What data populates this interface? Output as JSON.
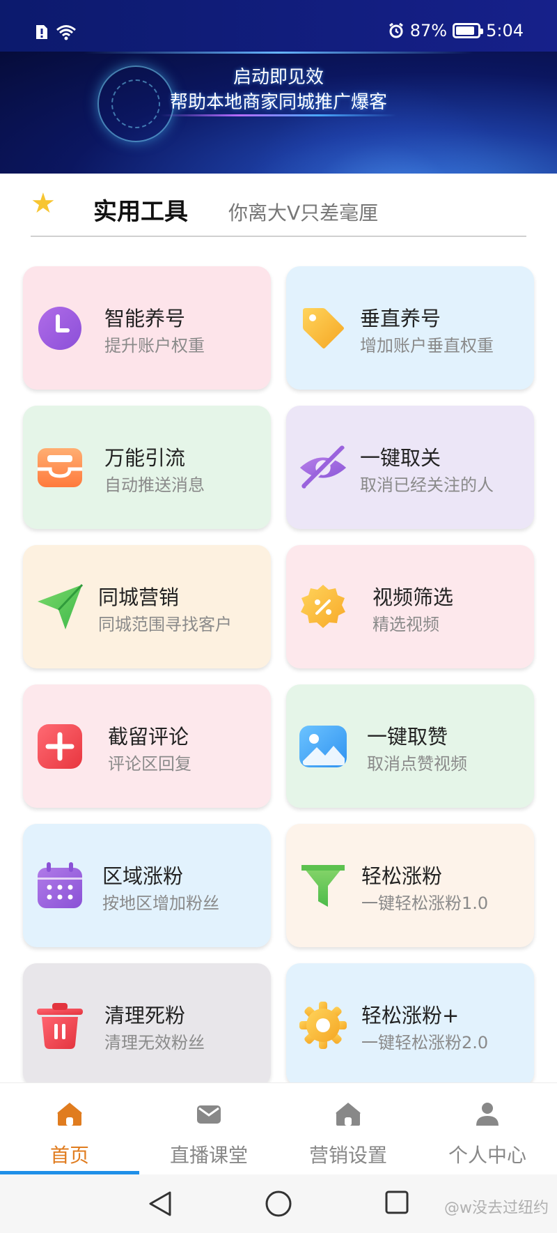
{
  "status_bar": {
    "battery": "87%",
    "battery_level": 0.87,
    "time": "5:04"
  },
  "banner": {
    "line1": "启动即见效",
    "line2": "帮助本地商家同城推广爆客"
  },
  "section": {
    "title": "实用工具",
    "subtitle": "你离大V只差毫厘"
  },
  "tools": [
    {
      "title": "智能养号",
      "subtitle": "提升账户权重",
      "bg": "#fde4ea",
      "icon": "clock-icon"
    },
    {
      "title": "垂直养号",
      "subtitle": "增加账户垂直权重",
      "bg": "#e2f2fd",
      "icon": "tag-icon"
    },
    {
      "title": "万能引流",
      "subtitle": "自动推送消息",
      "bg": "#e5f5e8",
      "icon": "inbox-icon"
    },
    {
      "title": "一键取关",
      "subtitle": "取消已经关注的人",
      "bg": "#ece6f7",
      "icon": "eye-off-icon"
    },
    {
      "title": "同城营销",
      "subtitle": "同城范围寻找客户",
      "bg": "#fdf1e0",
      "icon": "send-icon"
    },
    {
      "title": "视频筛选",
      "subtitle": "精选视频",
      "bg": "#fde8ec",
      "icon": "discount-badge-icon"
    },
    {
      "title": "截留评论",
      "subtitle": "评论区回复",
      "bg": "#fde8ec",
      "icon": "plus-square-icon"
    },
    {
      "title": "一键取赞",
      "subtitle": "取消点赞视频",
      "bg": "#e5f5e8",
      "icon": "image-icon"
    },
    {
      "title": "区域涨粉",
      "subtitle": "按地区增加粉丝",
      "bg": "#e2f2fd",
      "icon": "calendar-icon"
    },
    {
      "title": "轻松涨粉",
      "subtitle": "一键轻松涨粉1.0",
      "bg": "#fdf3ea",
      "icon": "funnel-icon"
    },
    {
      "title": "清理死粉",
      "subtitle": "清理无效粉丝",
      "bg": "#e8e6ea",
      "icon": "trash-icon"
    },
    {
      "title": "轻松涨粉+",
      "subtitle": "一键轻松涨粉2.0",
      "bg": "#e2f2fd",
      "icon": "gear-icon"
    }
  ],
  "nav": [
    {
      "label": "首页",
      "icon": "home-icon",
      "active": true
    },
    {
      "label": "直播课堂",
      "icon": "mail-icon",
      "active": false
    },
    {
      "label": "营销设置",
      "icon": "home-icon",
      "active": false
    },
    {
      "label": "个人中心",
      "icon": "user-icon",
      "active": false
    }
  ],
  "colors": {
    "active_nav": "#e07c1f",
    "indicator": "#1f8fe8"
  },
  "watermark": "@w没去过纽约"
}
